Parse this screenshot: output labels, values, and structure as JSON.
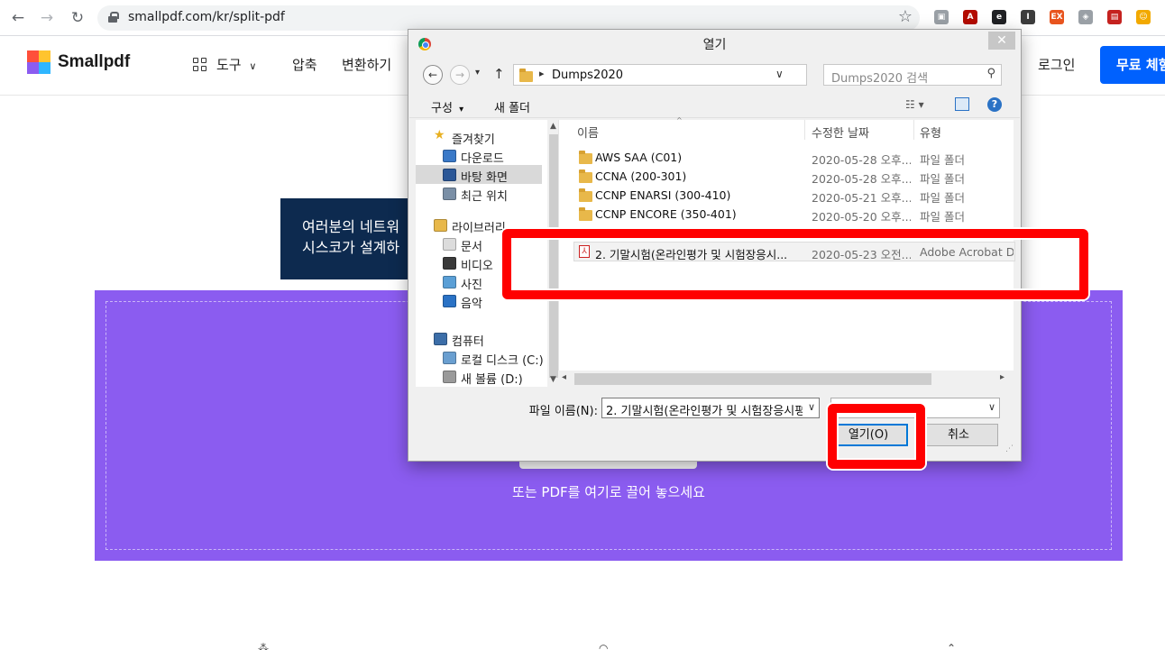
{
  "browser": {
    "url": "smallpdf.com/kr/split-pdf",
    "extensions": [
      {
        "name": "ext-gray-box-icon",
        "color": "#9aa0a6",
        "glyph": "▣"
      },
      {
        "name": "adobe-acrobat-icon",
        "color": "#b30b00",
        "glyph": "A"
      },
      {
        "name": "ext-dark-circle-icon",
        "color": "#202124",
        "glyph": "e"
      },
      {
        "name": "ext-info-icon",
        "color": "#3c3c3c",
        "glyph": "I"
      },
      {
        "name": "ext-orange-icon",
        "color": "#e8541e",
        "glyph": "EX"
      },
      {
        "name": "shield-icon",
        "color": "#9aa0a6",
        "glyph": "◈"
      },
      {
        "name": "ext-red-window-icon",
        "color": "#c5221f",
        "glyph": "▤"
      },
      {
        "name": "profile-avatar-icon",
        "color": "#f2a900",
        "glyph": "☺"
      }
    ]
  },
  "site": {
    "logo_text": "Smallpdf",
    "tools_label": "도구",
    "nav": [
      "압축",
      "변환하기"
    ],
    "login": "로그인",
    "signup": "무료 체험",
    "banner_line1": "여러분의 네트워",
    "banner_line2": "시스코가 설계하",
    "drop_text": "또는 PDF를 여기로 끌어 놓으세요"
  },
  "dialog": {
    "title": "열기",
    "path": "Dumps2020",
    "search_placeholder": "Dumps2020 검색",
    "toolbar": {
      "organize": "구성",
      "new_folder": "새 폴더"
    },
    "nav_pane": [
      {
        "label": "즐겨찾기",
        "icon": "star-icon",
        "indent": 0
      },
      {
        "label": "다운로드",
        "icon": "downloads-icon",
        "indent": 1
      },
      {
        "label": "바탕 화면",
        "icon": "desktop-icon",
        "indent": 1
      },
      {
        "label": "최근 위치",
        "icon": "recent-places-icon",
        "indent": 1
      },
      {
        "label": "라이브러리",
        "icon": "library-icon",
        "indent": 0
      },
      {
        "label": "문서",
        "icon": "documents-icon",
        "indent": 1
      },
      {
        "label": "비디오",
        "icon": "videos-icon",
        "indent": 1
      },
      {
        "label": "사진",
        "icon": "pictures-icon",
        "indent": 1
      },
      {
        "label": "음악",
        "icon": "music-icon",
        "indent": 1
      },
      {
        "label": "컴퓨터",
        "icon": "computer-icon",
        "indent": 0
      },
      {
        "label": "로컬 디스크 (C:)",
        "icon": "local-disk-icon",
        "indent": 1
      },
      {
        "label": "새 볼륨 (D:)",
        "icon": "volume-icon",
        "indent": 1
      }
    ],
    "columns": {
      "name": "이름",
      "date": "수정한 날짜",
      "type": "유형"
    },
    "files": [
      {
        "name": "AWS SAA (C01)",
        "date": "2020-05-28 오후...",
        "type": "파일 폴더",
        "kind": "folder"
      },
      {
        "name": "CCNA (200-301)",
        "date": "2020-05-28 오후...",
        "type": "파일 폴더",
        "kind": "folder"
      },
      {
        "name": "CCNP ENARSI (300-410)",
        "date": "2020-05-21 오후...",
        "type": "파일 폴더",
        "kind": "folder"
      },
      {
        "name": "CCNP ENCORE (350-401)",
        "date": "2020-05-20 오후...",
        "type": "파일 폴더",
        "kind": "folder"
      },
      {
        "name": "2. 기말시험(온라인평가 및 시험장응시...",
        "date": "2020-05-23 오전...",
        "type": "Adobe Acrobat D...",
        "kind": "pdf"
      }
    ],
    "filename_label": "파일 이름(N):",
    "filename_value": "2. 기말시험(온라인평가 및 시험장응시평",
    "open_button": "열기(O)",
    "cancel_button": "취소"
  },
  "colors": {
    "accent": "#0061fe",
    "dropzone": "#8b5cf0",
    "banner": "#0d2a4f",
    "highlight": "#ff0000"
  }
}
